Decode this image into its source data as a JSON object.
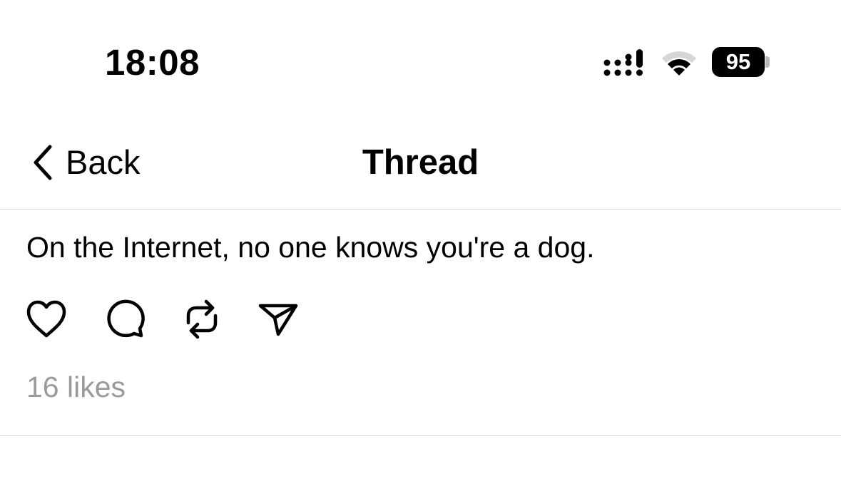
{
  "status_bar": {
    "time": "18:08",
    "battery_percent": "95",
    "signal_icon": "cellular-signal-icon",
    "wifi_icon": "wifi-icon"
  },
  "nav": {
    "back_label": "Back",
    "back_icon": "chevron-left-icon",
    "title": "Thread"
  },
  "post": {
    "text": "On the Internet, no one knows you're a dog.",
    "actions": [
      {
        "name": "like",
        "icon": "heart-icon"
      },
      {
        "name": "reply",
        "icon": "comment-icon"
      },
      {
        "name": "repost",
        "icon": "repost-icon"
      },
      {
        "name": "share",
        "icon": "send-icon"
      }
    ],
    "likes_label": "16 likes"
  },
  "colors": {
    "text": "#000000",
    "secondary_text": "#9a9a9a",
    "divider": "#d8d8d8",
    "background": "#ffffff"
  }
}
